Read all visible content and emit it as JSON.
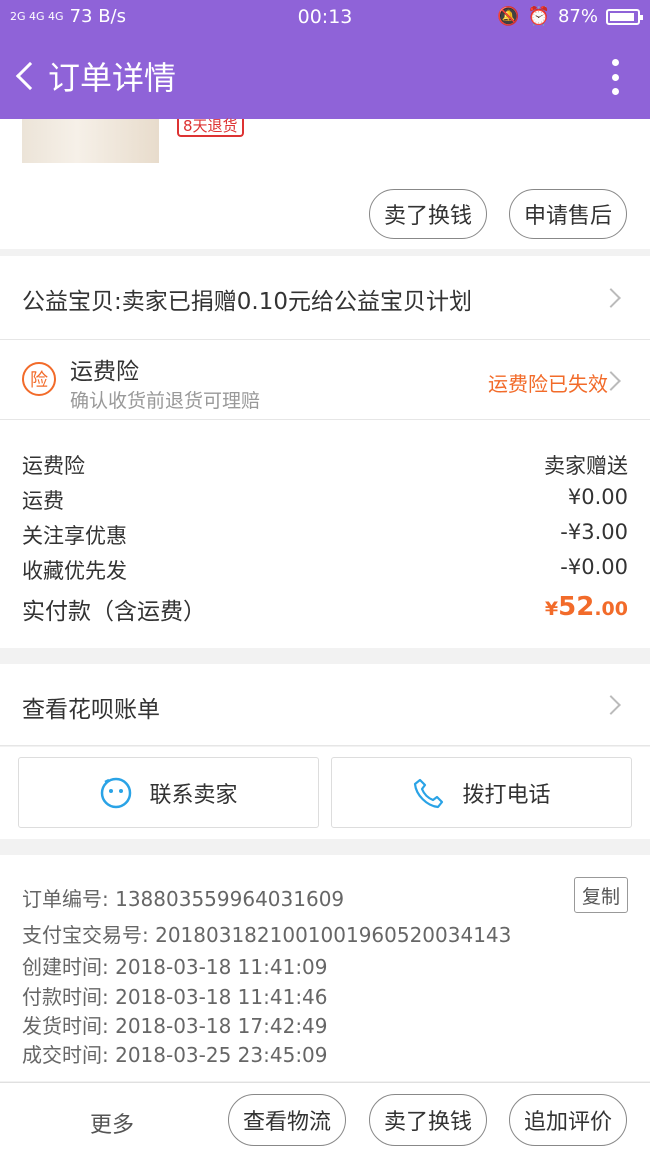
{
  "status_bar": {
    "network": "2G 4G 4G",
    "speed": "73 B/s",
    "time": "00:13",
    "battery": "87%"
  },
  "app_bar": {
    "title": "订单详情",
    "icons": [
      "back-icon",
      "more-vertical-icon"
    ]
  },
  "product": {
    "tag": "8天退货",
    "buttons": [
      "卖了换钱",
      "申请售后"
    ]
  },
  "charity": {
    "text": "公益宝贝:卖家已捐赠0.10元给公益宝贝计划"
  },
  "insurance": {
    "icon_text": "险",
    "title": "运费险",
    "subtitle": "确认收货前退货可理赔",
    "status": "运费险已失效",
    "accent": "#f26b2a"
  },
  "fees": {
    "rows": [
      {
        "label": "运费险",
        "value": "卖家赠送"
      },
      {
        "label": "运费",
        "value": "¥0.00"
      },
      {
        "label": "关注享优惠",
        "value": "-¥3.00"
      },
      {
        "label": "收藏优先发",
        "value": "-¥0.00"
      }
    ],
    "total_label": "实付款（含运费）",
    "total_currency": "¥",
    "total_int": "52",
    "total_dec": ".00"
  },
  "huabei": {
    "text": "查看花呗账单"
  },
  "contact": {
    "seller_label": "联系卖家",
    "phone_label": "拨打电话"
  },
  "order_info": {
    "copy_label": "复制",
    "lines": [
      "订单编号: 138803559964031609",
      "支付宝交易号: 2018031821001001960520034143",
      "创建时间: 2018-03-18 11:41:09",
      "付款时间: 2018-03-18 11:41:46",
      "发货时间: 2018-03-18 17:42:49",
      "成交时间: 2018-03-25 23:45:09"
    ]
  },
  "bottom_bar": {
    "more_label": "更多",
    "buttons": [
      "查看物流",
      "卖了换钱",
      "追加评价"
    ]
  },
  "colors": {
    "header": "#8f63d8",
    "accent": "#f26b2a"
  }
}
